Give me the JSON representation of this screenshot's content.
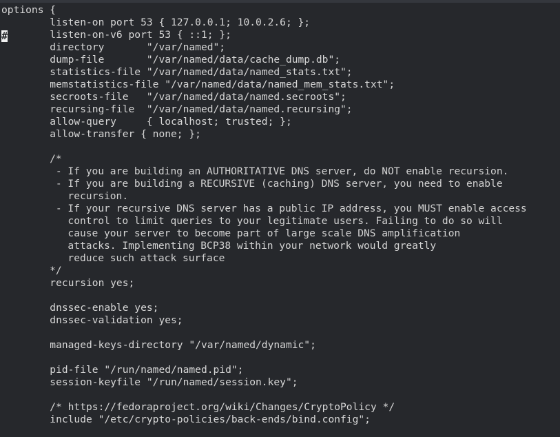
{
  "terminal": {
    "background_color": "#26282c",
    "foreground_color": "#d7d7d7",
    "top_bar_color": "#34373d"
  },
  "cursor": {
    "glyph": "#",
    "background_color": "#f2f2f2",
    "foreground_color": "#1d1f22",
    "line": 3,
    "column": 1
  },
  "file": {
    "lines": [
      "options {",
      "        listen-on port 53 { 127.0.0.1; 10.0.2.6; };",
      "        listen-on-v6 port 53 { ::1; };",
      "        directory       \"/var/named\";",
      "        dump-file       \"/var/named/data/cache_dump.db\";",
      "        statistics-file \"/var/named/data/named_stats.txt\";",
      "        memstatistics-file \"/var/named/data/named_mem_stats.txt\";",
      "        secroots-file   \"/var/named/data/named.secroots\";",
      "        recursing-file  \"/var/named/data/named.recursing\";",
      "        allow-query     { localhost; trusted; };",
      "        allow-transfer { none; };",
      "",
      "        /*",
      "         - If you are building an AUTHORITATIVE DNS server, do NOT enable recursion.",
      "         - If you are building a RECURSIVE (caching) DNS server, you need to enable",
      "           recursion.",
      "         - If your recursive DNS server has a public IP address, you MUST enable access",
      "           control to limit queries to your legitimate users. Failing to do so will",
      "           cause your server to become part of large scale DNS amplification",
      "           attacks. Implementing BCP38 within your network would greatly",
      "           reduce such attack surface",
      "        */",
      "        recursion yes;",
      "",
      "        dnssec-enable yes;",
      "        dnssec-validation yes;",
      "",
      "        managed-keys-directory \"/var/named/dynamic\";",
      "",
      "        pid-file \"/run/named/named.pid\";",
      "        session-keyfile \"/run/named/session.key\";",
      "",
      "        /* https://fedoraproject.org/wiki/Changes/CryptoPolicy */",
      "        include \"/etc/crypto-policies/back-ends/bind.config\";"
    ],
    "comment_line_indices": [
      12,
      13,
      14,
      15,
      16,
      17,
      18,
      19,
      20,
      21
    ]
  }
}
